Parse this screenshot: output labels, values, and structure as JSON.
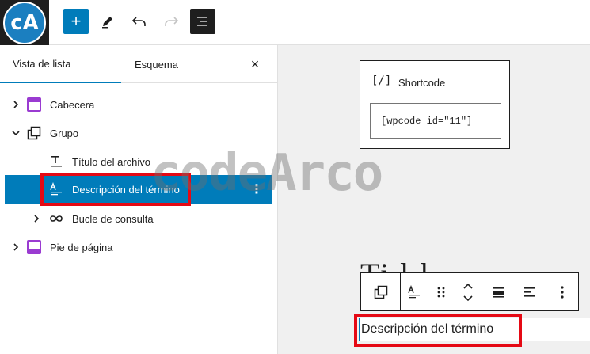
{
  "logo": {
    "text": "cA"
  },
  "toolbar": {
    "add_label": "+",
    "icons": [
      "plus-icon",
      "pencil-icon",
      "undo-icon",
      "redo-icon",
      "list-view-icon"
    ]
  },
  "sidebar": {
    "tabs": [
      {
        "label": "Vista de lista",
        "active": true
      },
      {
        "label": "Esquema",
        "active": false
      }
    ],
    "close_label": "×",
    "items": [
      {
        "label": "Cabecera",
        "icon": "template-part-icon",
        "expanded": false
      },
      {
        "label": "Grupo",
        "icon": "group-icon",
        "expanded": true
      },
      {
        "label": "Título del archivo",
        "icon": "archive-title-icon"
      },
      {
        "label": "Descripción del término",
        "icon": "term-description-icon",
        "selected": true
      },
      {
        "label": "Bucle de consulta",
        "icon": "query-loop-icon",
        "expanded": false
      },
      {
        "label": "Pie de página",
        "icon": "template-part-icon",
        "expanded": false
      }
    ],
    "kebab": "⋮"
  },
  "canvas": {
    "shortcode": {
      "icon_text": "[/]",
      "title": "Shortcode",
      "value": "[wpcode id=\"11\"]"
    },
    "heading_partial": "Ti      l      l",
    "description_text": "Descripción del término"
  },
  "watermark": "codeArco",
  "colors": {
    "accent": "#007cba",
    "highlight": "#e50914",
    "dark": "#1e1e1e"
  }
}
